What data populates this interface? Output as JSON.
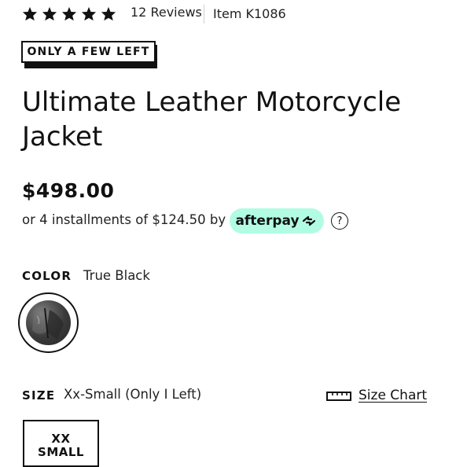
{
  "rating": {
    "stars": 5,
    "star_icon": "star-icon",
    "reviews_label": "12 Reviews",
    "item_label": "Item K1086"
  },
  "badge": {
    "label": "ONLY A FEW LEFT"
  },
  "product": {
    "title": "Ultimate Leather Motorcycle Jacket",
    "price": "$498.00"
  },
  "installments": {
    "text": "or 4 installments of $124.50 by",
    "provider": "afterpay",
    "provider_color": "#b2fce4",
    "help_icon": "question-circle-icon",
    "help_glyph": "?"
  },
  "color": {
    "label": "COLOR",
    "value": "True Black"
  },
  "size": {
    "label": "SIZE",
    "value": "Xx-Small (Only I Left)",
    "chart_icon": "ruler-icon",
    "chart_link": "Size Chart",
    "options": [
      {
        "line1": "XX",
        "line2": "SMALL"
      }
    ]
  }
}
